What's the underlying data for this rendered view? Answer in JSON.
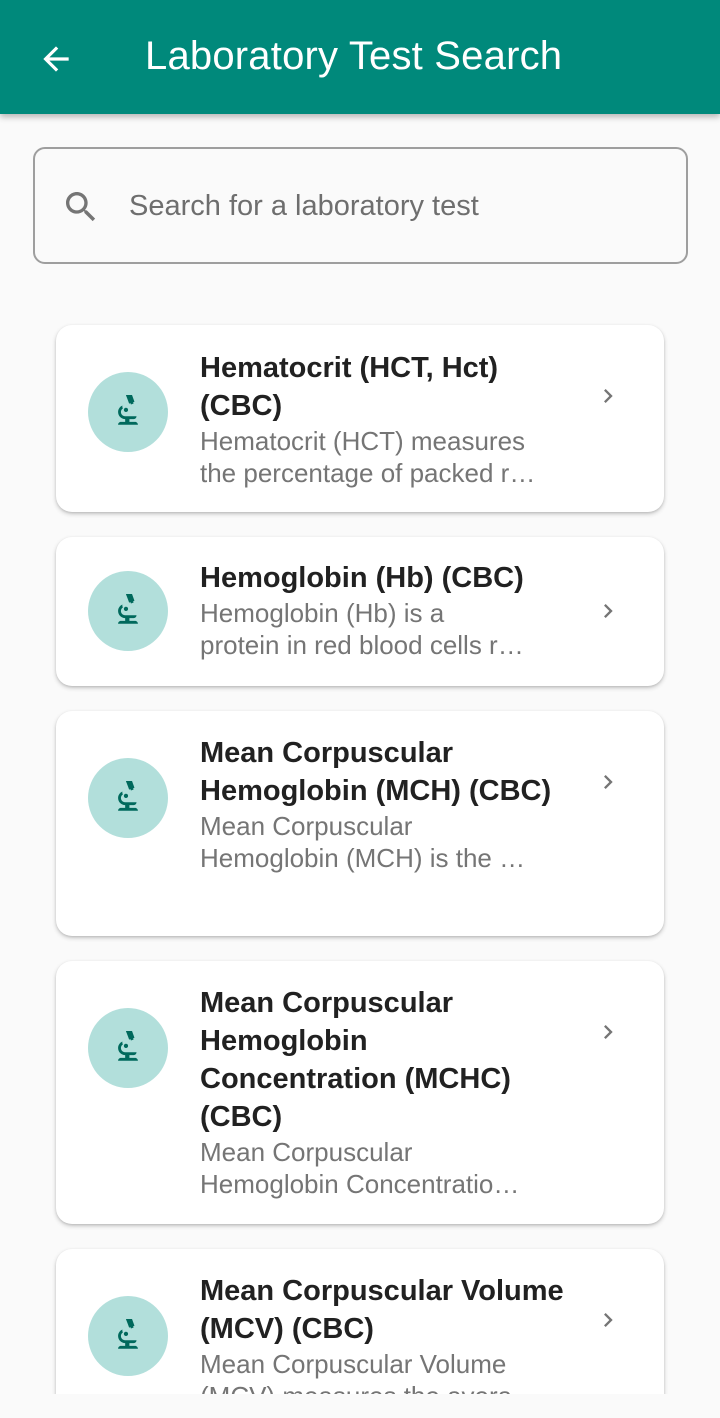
{
  "appbar": {
    "title": "Laboratory Test Search",
    "back_icon": "arrow-back-icon",
    "color": "#00897b"
  },
  "search": {
    "placeholder": "Search for a laboratory test",
    "value": "",
    "icon": "search-icon"
  },
  "tests": [
    {
      "title": "Hematocrit (HCT, Hct) (CBC)",
      "desc_line1": "Hematocrit (HCT) measures",
      "desc_line2": "the percentage of packed r…",
      "icon": "microscope-icon"
    },
    {
      "title": "Hemoglobin (Hb) (CBC)",
      "desc_line1": "Hemoglobin (Hb) is a",
      "desc_line2": "protein in red blood cells r…",
      "icon": "microscope-icon"
    },
    {
      "title": "Mean Corpuscular Hemoglobin (MCH) (CBC)",
      "desc_line1": "Mean Corpuscular",
      "desc_line2": "Hemoglobin (MCH) is the …",
      "icon": "microscope-icon"
    },
    {
      "title": "Mean Corpuscular Hemoglobin Concentration (MCHC) (CBC)",
      "desc_line1": "Mean Corpuscular",
      "desc_line2": "Hemoglobin Concentratio…",
      "icon": "microscope-icon"
    },
    {
      "title": "Mean Corpuscular Volume (MCV) (CBC)",
      "desc_line1": "Mean Corpuscular Volume",
      "desc_line2": "(MCV) measures the avera…",
      "icon": "microscope-icon"
    }
  ],
  "colors": {
    "accent": "#00897b",
    "avatar_bg": "#b2dfdb",
    "icon": "#00695c"
  }
}
